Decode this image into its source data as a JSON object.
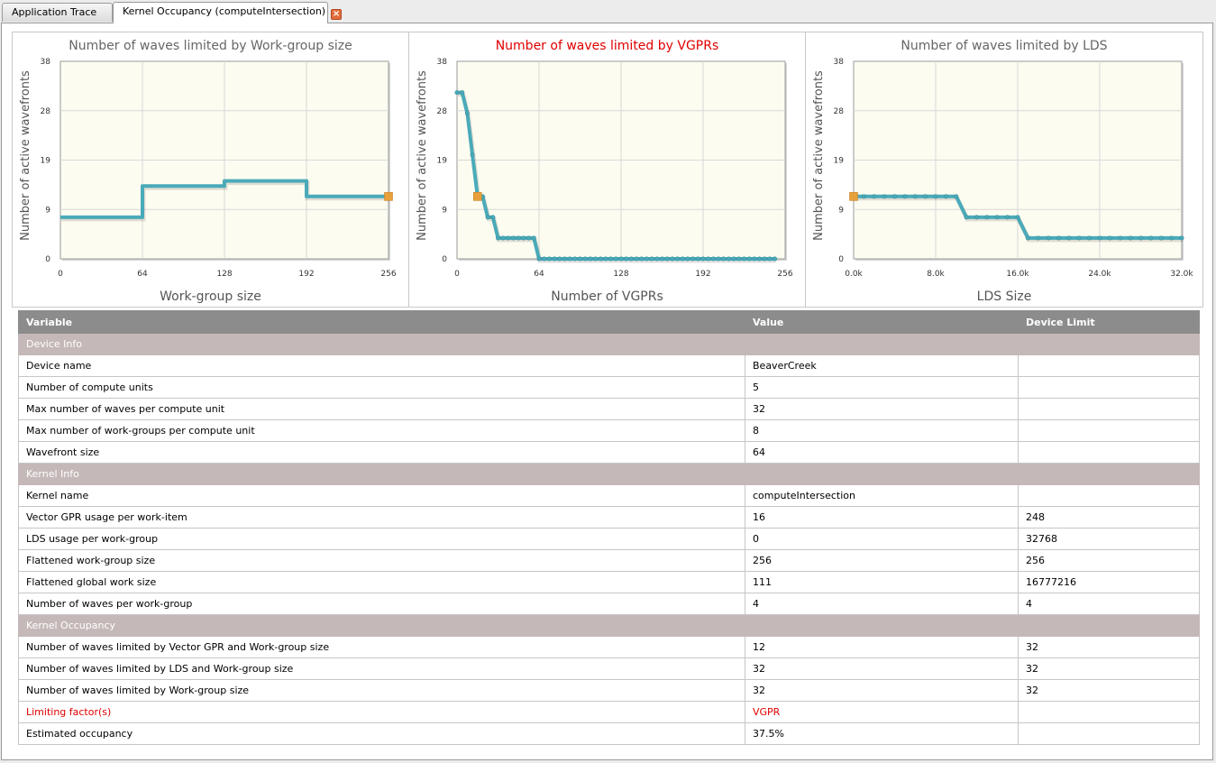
{
  "tabs": [
    {
      "label": "Application Trace"
    },
    {
      "label": "Kernel Occupancy (computeIntersection)"
    }
  ],
  "colors": {
    "line": "#4aaab9",
    "marker": "#e8a13a",
    "plot_bg": "#fdfcf1",
    "title_highlight": "#e00000",
    "section_bg": "#c5b8b8",
    "header_bg": "#8c8c8c"
  },
  "chart_data": [
    {
      "type": "line",
      "title": "Number of waves limited by Work-group size",
      "title_highlight": false,
      "xlabel": "Work-group size",
      "ylabel": "Number of active wavefronts",
      "xlim": [
        0,
        256
      ],
      "ylim": [
        0,
        38
      ],
      "xticks": [
        "0",
        "64",
        "128",
        "192",
        "256"
      ],
      "yticks": [
        "0",
        "9",
        "19",
        "28",
        "38"
      ],
      "grid": true,
      "markers": false,
      "x": [
        0,
        64,
        64,
        128,
        128,
        192,
        192,
        256
      ],
      "y": [
        8,
        8,
        14,
        14,
        15,
        15,
        12,
        12
      ],
      "highlight": {
        "x": 256,
        "y": 12
      }
    },
    {
      "type": "line",
      "title": "Number of waves limited by VGPRs",
      "title_highlight": true,
      "xlabel": "Number of VGPRs",
      "ylabel": "Number of active wavefronts",
      "xlim": [
        0,
        256
      ],
      "ylim": [
        0,
        38
      ],
      "xticks": [
        "0",
        "64",
        "128",
        "192",
        "256"
      ],
      "yticks": [
        "0",
        "9",
        "19",
        "28",
        "38"
      ],
      "grid": true,
      "markers": true,
      "x": [
        0,
        4,
        8,
        12,
        16,
        20,
        24,
        28,
        32,
        36,
        40,
        44,
        48,
        52,
        56,
        60,
        64,
        68,
        72,
        76,
        80,
        84,
        88,
        92,
        96,
        100,
        104,
        108,
        112,
        116,
        120,
        124,
        128,
        132,
        136,
        140,
        144,
        148,
        152,
        156,
        160,
        164,
        168,
        172,
        176,
        180,
        184,
        188,
        192,
        196,
        200,
        204,
        208,
        212,
        216,
        220,
        224,
        228,
        232,
        236,
        240,
        244,
        248
      ],
      "y": [
        32,
        32,
        28,
        20,
        12,
        12,
        8,
        8,
        4,
        4,
        4,
        4,
        4,
        4,
        4,
        4,
        0,
        0,
        0,
        0,
        0,
        0,
        0,
        0,
        0,
        0,
        0,
        0,
        0,
        0,
        0,
        0,
        0,
        0,
        0,
        0,
        0,
        0,
        0,
        0,
        0,
        0,
        0,
        0,
        0,
        0,
        0,
        0,
        0,
        0,
        0,
        0,
        0,
        0,
        0,
        0,
        0,
        0,
        0,
        0,
        0,
        0,
        0
      ],
      "highlight": {
        "x": 16,
        "y": 12
      }
    },
    {
      "type": "line",
      "title": "Number of waves limited by LDS",
      "title_highlight": false,
      "xlabel": "LDS Size",
      "ylabel": "Number of active wavefronts",
      "xlim": [
        0,
        32768
      ],
      "ylim": [
        0,
        38
      ],
      "xticks": [
        "0.0k",
        "8.0k",
        "16.0k",
        "24.0k",
        "32.0k"
      ],
      "yticks": [
        "0",
        "9",
        "19",
        "28",
        "38"
      ],
      "grid": true,
      "markers": true,
      "x": [
        0,
        1024,
        2048,
        3072,
        4096,
        5120,
        6144,
        7168,
        8192,
        9216,
        10240,
        11264,
        12288,
        13312,
        14336,
        15360,
        16384,
        17408,
        18432,
        19456,
        20480,
        21504,
        22528,
        23552,
        24576,
        25600,
        26624,
        27648,
        28672,
        29696,
        30720,
        31744,
        32768
      ],
      "y": [
        12,
        12,
        12,
        12,
        12,
        12,
        12,
        12,
        12,
        12,
        12,
        8,
        8,
        8,
        8,
        8,
        8,
        4,
        4,
        4,
        4,
        4,
        4,
        4,
        4,
        4,
        4,
        4,
        4,
        4,
        4,
        4,
        4
      ],
      "highlight": {
        "x": 0,
        "y": 12
      }
    }
  ],
  "table": {
    "headers": [
      "Variable",
      "Value",
      "Device Limit"
    ],
    "rows": [
      {
        "section": "Device Info"
      },
      {
        "cells": [
          "Device name",
          "BeaverCreek",
          ""
        ]
      },
      {
        "cells": [
          "Number of compute units",
          "5",
          ""
        ]
      },
      {
        "cells": [
          "Max number of waves per compute unit",
          "32",
          ""
        ]
      },
      {
        "cells": [
          "Max number of work-groups per compute unit",
          "8",
          ""
        ]
      },
      {
        "cells": [
          "Wavefront size",
          "64",
          ""
        ]
      },
      {
        "section": "Kernel Info"
      },
      {
        "cells": [
          "Kernel name",
          "computeIntersection",
          ""
        ]
      },
      {
        "cells": [
          "Vector GPR usage per work-item",
          "16",
          "248"
        ]
      },
      {
        "cells": [
          "LDS usage per work-group",
          "0",
          "32768"
        ]
      },
      {
        "cells": [
          "Flattened work-group size",
          "256",
          "256"
        ]
      },
      {
        "cells": [
          "Flattened global work size",
          "111",
          "16777216"
        ]
      },
      {
        "cells": [
          "Number of waves per work-group",
          "4",
          "4"
        ]
      },
      {
        "section": "Kernel Occupancy"
      },
      {
        "cells": [
          "Number of waves limited by Vector GPR and Work-group size",
          "12",
          "32"
        ]
      },
      {
        "cells": [
          "Number of waves limited by LDS and Work-group size",
          "32",
          "32"
        ]
      },
      {
        "cells": [
          "Number of waves limited by Work-group size",
          "32",
          "32"
        ]
      },
      {
        "cells": [
          "Limiting factor(s)",
          "VGPR",
          ""
        ],
        "highlight": true
      },
      {
        "cells": [
          "Estimated occupancy",
          "37.5%",
          ""
        ]
      }
    ]
  }
}
